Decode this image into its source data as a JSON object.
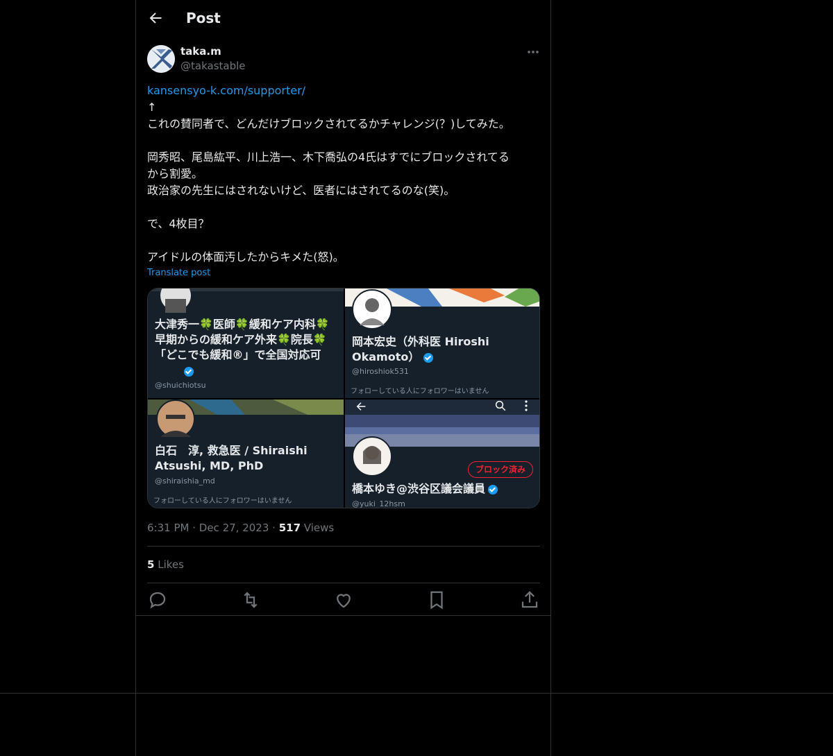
{
  "header": {
    "title": "Post",
    "back_icon": "back-arrow-icon"
  },
  "post": {
    "display_name": "taka.m",
    "handle": "@takastable",
    "link_text": "kansensyo-k.com/supporter/",
    "body_lines": "↑\nこれの賛同者で、どんだけブロックされてるかチャレンジ(？)してみた。\n\n岡秀昭、尾島紘平、川上浩一、木下喬弘の4氏はすでにブロックされてる\nから割愛。\n政治家の先生にはされないけど、医者にはされてるのな(笑)。\n\nで、4枚目？\n\nアイドルの体面汚したからキメた(怒)。",
    "translate_label": "Translate post",
    "time": "6:31 PM",
    "date": "Dec 27, 2023",
    "views_count": "517",
    "views_label": "Views",
    "likes_count": "5",
    "likes_label": "Likes"
  },
  "media": [
    {
      "name": "大津秀一🍀医師🍀緩和ケア内科🍀早期からの緩和ケア外来🍀院長🍀「どこでも緩和®」で全国対応可",
      "handle": "@shuichiotsu"
    },
    {
      "name": "岡本宏史（外科医 Hiroshi Okamoto）",
      "handle": "@hiroshiok531",
      "follow_note": "フォローしている人にフォロワーはいません"
    },
    {
      "name": "白石　淳, 救急医 / Shiraishi Atsushi, MD, PhD",
      "handle": "@shiraishia_md",
      "follow_note": "フォローしている人にフォロワーはいません"
    },
    {
      "name": "橋本ゆき@渋谷区議会議員",
      "handle": "@yuki_12hsm",
      "blocked_label": "ブロック済み"
    }
  ],
  "colors": {
    "accent": "#1d9bf0",
    "bg": "#000000",
    "muted": "#71767b",
    "blocked": "#f4212e"
  }
}
